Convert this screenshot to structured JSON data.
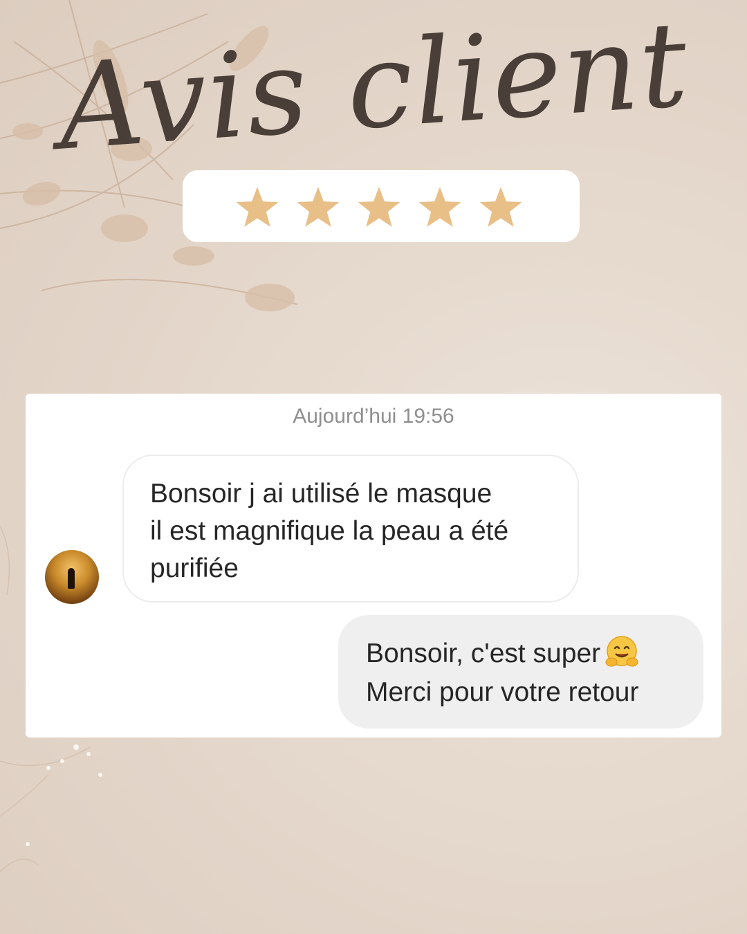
{
  "title": "Avis client",
  "rating": {
    "stars": 5,
    "max": 5,
    "star_color": "#e9bf88"
  },
  "chat": {
    "timestamp": "Aujourd’hui 19:56",
    "incoming": {
      "text": "Bonsoir j ai utilisé  le masque\nil est magnifique la peau a été\npurifiée",
      "avatar_icon": "avatar-photo"
    },
    "outgoing": {
      "line1": "Bonsoir, c'est super",
      "emoji": "hugging-face-icon",
      "line2": "Merci pour votre retour"
    }
  },
  "colors": {
    "background": "#e5d8cc",
    "title": "#4a3f38",
    "bubble_incoming": "#ffffff",
    "bubble_outgoing": "#efefef"
  }
}
